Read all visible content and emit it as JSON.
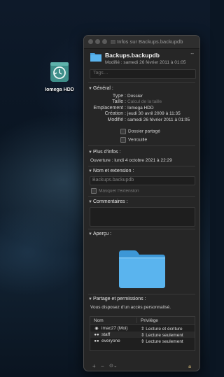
{
  "desktop": {
    "drive_label": "Iomega HDD"
  },
  "window": {
    "title": "Infos sur Backups.backupdb",
    "name": "Backups.backupdb",
    "size": "--",
    "modified": "Modifié : samedi 26 février 2011 à 01:05",
    "tags_placeholder": "Tags…"
  },
  "general": {
    "title": "Général :",
    "rows": [
      {
        "key": "Type :",
        "value": "Dossier",
        "muted": false
      },
      {
        "key": "Taille :",
        "value": "Calcul de la taille",
        "muted": true
      },
      {
        "key": "Emplacement :",
        "value": "Iomega HDD",
        "muted": false
      },
      {
        "key": "Création :",
        "value": "jeudi 30 avril 2009 à 11:35",
        "muted": false
      },
      {
        "key": "Modifié :",
        "value": "samedi 26 février 2011 à 01:05",
        "muted": false
      }
    ],
    "shared_label": "Dossier partagé",
    "locked_label": "Verrouillé"
  },
  "more_info": {
    "title": "Plus d'infos :",
    "opened": "Ouverture : lundi 4 octobre 2021 à 22:29"
  },
  "name_ext": {
    "title": "Nom et extension :",
    "value": "Backups.backupdb",
    "hide_ext_label": "Masquer l'extension"
  },
  "comments": {
    "title": "Commentaires :"
  },
  "preview": {
    "title": "Aperçu :"
  },
  "permissions": {
    "title": "Partage et permissions :",
    "access_note": "Vous disposez d'un accès personnalisé.",
    "col_name": "Nom",
    "col_priv": "Privilège",
    "rows": [
      {
        "name": "imac27 (Moi)",
        "priv": "Lecture et écriture",
        "icon": "person-icon"
      },
      {
        "name": "staff",
        "priv": "Lecture seulement",
        "icon": "group-icon"
      },
      {
        "name": "everyone",
        "priv": "Lecture seulement",
        "icon": "group-icon"
      }
    ],
    "toolbar": {
      "add": "+",
      "remove": "−",
      "action": "⊙⌄"
    }
  },
  "colors": {
    "accent": "#4aa3e0",
    "folder": "#5ab4ee",
    "window_bg": "#262626"
  }
}
